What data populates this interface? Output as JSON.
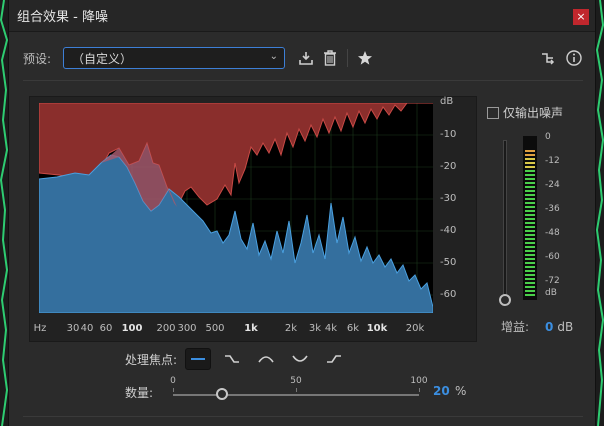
{
  "window": {
    "title": "组合效果 - 降噪",
    "close_glyph": "×"
  },
  "preset": {
    "label": "预设:",
    "value": "（自定义）"
  },
  "toolbar": {
    "icons": [
      "save-preset-icon",
      "delete-icon",
      "favorite-star-icon",
      "route-icon",
      "info-icon"
    ]
  },
  "graph": {
    "y_unit": "dB",
    "y_ticks": [
      "-10",
      "-20",
      "-30",
      "-40",
      "-50",
      "-60"
    ],
    "x_unit": "Hz",
    "x_ticks": [
      {
        "label": "30",
        "bold": false
      },
      {
        "label": "40",
        "bold": false
      },
      {
        "label": "60",
        "bold": false
      },
      {
        "label": "100",
        "bold": true
      },
      {
        "label": "200",
        "bold": false
      },
      {
        "label": "300",
        "bold": false
      },
      {
        "label": "500",
        "bold": false
      },
      {
        "label": "1k",
        "bold": true
      },
      {
        "label": "2k",
        "bold": false
      },
      {
        "label": "3k",
        "bold": false
      },
      {
        "label": "4k",
        "bold": false
      },
      {
        "label": "6k",
        "bold": false
      },
      {
        "label": "10k",
        "bold": true
      },
      {
        "label": "20k",
        "bold": false
      }
    ],
    "noise_color": "#b8403d",
    "signal_color": "#3c84c4"
  },
  "output_noise_only": {
    "label": "仅输出噪声",
    "checked": false
  },
  "meter": {
    "scale": [
      "0",
      "-12",
      "-24",
      "-36",
      "-48",
      "-60",
      "-72",
      "dB"
    ]
  },
  "gain": {
    "label": "增益:",
    "value": "0",
    "unit": "dB"
  },
  "focus": {
    "label": "处理焦点:",
    "selected": 0,
    "options": [
      "flat-focus-icon",
      "low-focus-icon",
      "mid-focus-icon",
      "high-mid-focus-icon",
      "high-focus-icon"
    ]
  },
  "amount": {
    "label": "数量:",
    "ticks": [
      "0",
      "50",
      "100"
    ],
    "value": "20",
    "value_fraction": 0.2,
    "unit": "%"
  },
  "accent_color": "#3b8ee0"
}
